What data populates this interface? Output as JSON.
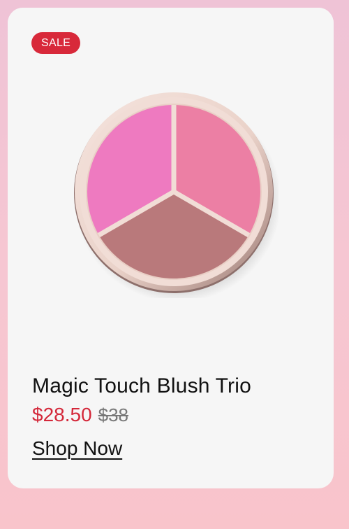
{
  "product": {
    "badge": "SALE",
    "name": "Magic Touch Blush Trio",
    "sale_price": "$28.50",
    "original_price": "$38",
    "cta_label": "Shop Now",
    "image_icon": "blush-trio-palette",
    "colors": {
      "badge": "#d8293a",
      "sale_price": "#d4283a",
      "shade_left": "#ee7ac0",
      "shade_right": "#ec7fa4",
      "shade_bottom": "#b9797b"
    }
  }
}
